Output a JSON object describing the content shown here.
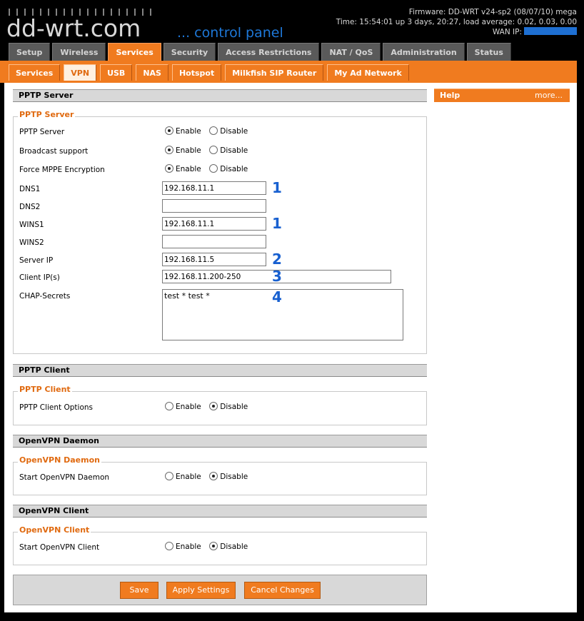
{
  "header": {
    "logo": "dd-wrt.com",
    "tagline": "... control panel",
    "firmware": "Firmware: DD-WRT v24-sp2 (08/07/10) mega",
    "time": "Time: 15:54:01 up 3 days, 20:27, load average: 0.02, 0.03, 0.00",
    "wan_ip_label": "WAN IP:"
  },
  "main_tabs": [
    "Setup",
    "Wireless",
    "Services",
    "Security",
    "Access Restrictions",
    "NAT / QoS",
    "Administration",
    "Status"
  ],
  "sub_tabs": [
    "Services",
    "VPN",
    "USB",
    "NAS",
    "Hotspot",
    "Milkfish SIP Router",
    "My Ad Network"
  ],
  "common": {
    "enable": "Enable",
    "disable": "Disable"
  },
  "pptp_server": {
    "header": "PPTP Server",
    "legend": "PPTP Server",
    "server_label": "PPTP Server",
    "broadcast_label": "Broadcast support",
    "mppe_label": "Force MPPE Encryption",
    "dns1_label": "DNS1",
    "dns1": "192.168.11.1",
    "dns2_label": "DNS2",
    "dns2": "",
    "wins1_label": "WINS1",
    "wins1": "192.168.11.1",
    "wins2_label": "WINS2",
    "wins2": "",
    "server_ip_label": "Server IP",
    "server_ip": "192.168.11.5",
    "client_ips_label": "Client IP(s)",
    "client_ips": "192.168.11.200-250",
    "chap_label": "CHAP-Secrets",
    "chap": "test * test *",
    "annotations": [
      "1",
      "1",
      "2",
      "3",
      "4"
    ]
  },
  "pptp_client": {
    "header": "PPTP Client",
    "legend": "PPTP Client",
    "options_label": "PPTP Client Options"
  },
  "openvpn_daemon": {
    "header": "OpenVPN Daemon",
    "legend": "OpenVPN Daemon",
    "start_label": "Start OpenVPN Daemon"
  },
  "openvpn_client": {
    "header": "OpenVPN Client",
    "legend": "OpenVPN Client",
    "start_label": "Start OpenVPN Client"
  },
  "help": {
    "title": "Help",
    "more": "more..."
  },
  "buttons": {
    "save": "Save",
    "apply": "Apply Settings",
    "cancel": "Cancel Changes"
  },
  "colors": {
    "accent": "#f07b1f",
    "annotation": "#1860d0",
    "wan_ip": "#1e6fd2"
  }
}
